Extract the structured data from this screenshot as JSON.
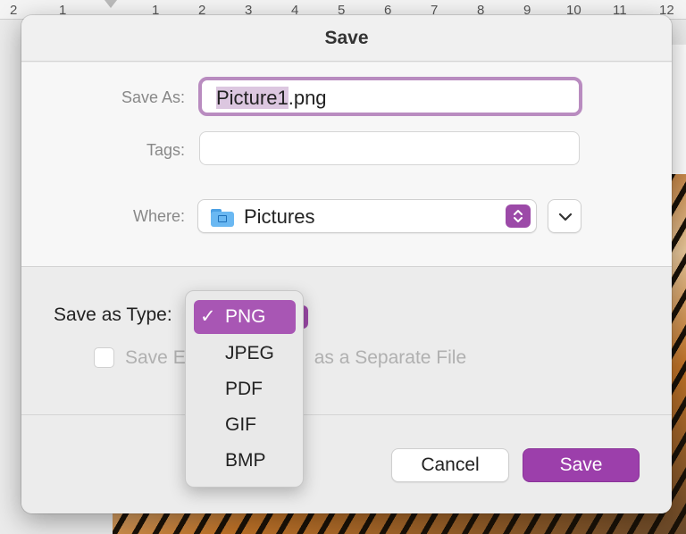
{
  "ruler": {
    "numbers": [
      "2",
      "1",
      "1",
      "2",
      "3",
      "4",
      "5",
      "6",
      "7",
      "8",
      "9",
      "10",
      "11",
      "12"
    ]
  },
  "dialog": {
    "title": "Save",
    "save_as_label": "Save As:",
    "filename_selected": "Picture1",
    "filename_ext": ".png",
    "tags_label": "Tags:",
    "tags_value": "",
    "where_label": "Where:",
    "where_value": "Pictures",
    "where_icon": "folder-pictures-icon",
    "save_as_type_label": "Save as Type:",
    "checkbox_label_left": "Save E",
    "checkbox_label_right": "as a Separate File",
    "checkbox_checked": false,
    "cancel_label": "Cancel",
    "save_label": "Save",
    "accent_color": "#9c3fab"
  },
  "type_menu": {
    "check_glyph": "✓",
    "selected": "PNG",
    "options": [
      "PNG",
      "JPEG",
      "PDF",
      "GIF",
      "BMP"
    ]
  }
}
